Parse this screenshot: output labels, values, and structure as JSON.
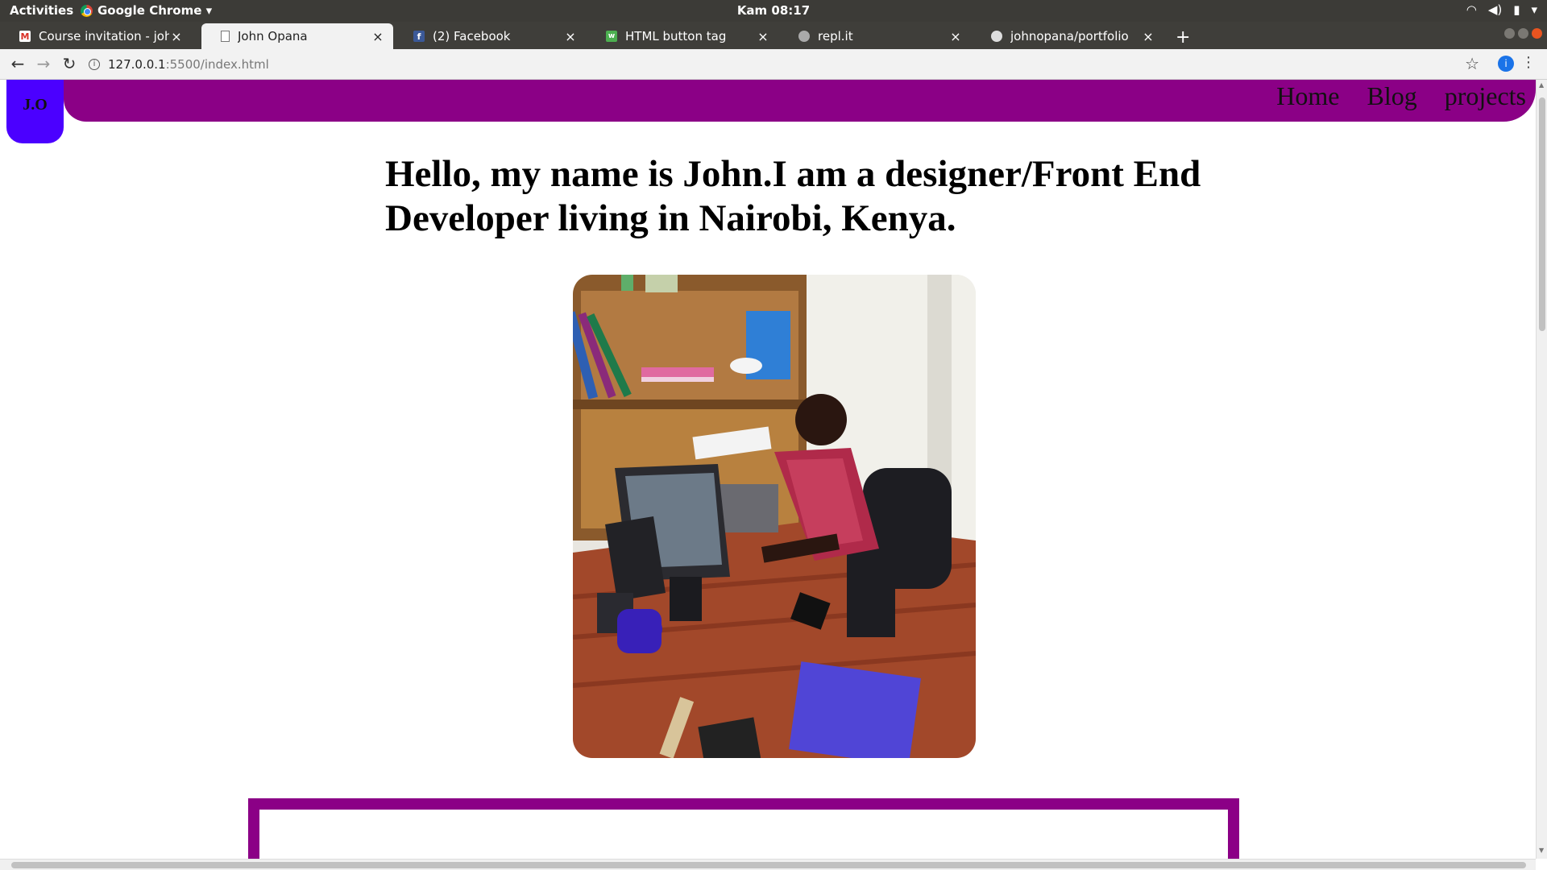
{
  "system": {
    "activities": "Activities",
    "app_name": "Google Chrome ▾",
    "clock": "Kam 08:17",
    "tray_icons": [
      "wifi-icon",
      "volume-icon",
      "battery-icon",
      "power-menu-icon"
    ]
  },
  "browser": {
    "tabs": [
      {
        "title": "Course invitation - johnop",
        "icon": "gmail-icon",
        "active": false
      },
      {
        "title": "John Opana",
        "icon": "page-icon",
        "active": true
      },
      {
        "title": "(2) Facebook",
        "icon": "facebook-icon",
        "active": false
      },
      {
        "title": "HTML button tag",
        "icon": "w3schools-icon",
        "active": false
      },
      {
        "title": "repl.it",
        "icon": "replit-icon",
        "active": false
      },
      {
        "title": "johnopana/portfolio",
        "icon": "github-icon",
        "active": false
      }
    ],
    "tab_close": "×",
    "new_tab": "+",
    "url_host": "127.0.0.1",
    "url_path": ":5500/index.html",
    "profile_initial": "i"
  },
  "page": {
    "logo_text": "J.O",
    "nav": [
      "Home",
      "Blog",
      "projects"
    ],
    "hero_title": "Hello, my name is John.I am a designer/Front End Developer living in Nairobi, Kenya.",
    "colors": {
      "nav_bg": "#8b0086",
      "logo_bg": "#4b00ff"
    }
  }
}
